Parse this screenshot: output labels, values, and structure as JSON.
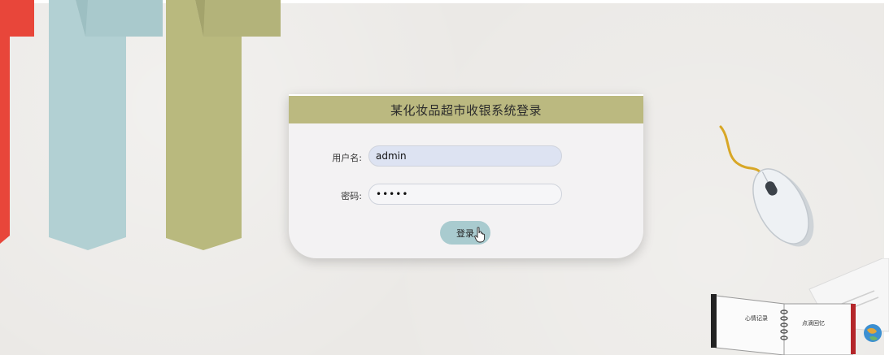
{
  "login": {
    "title": "某化妆品超市收银系统登录",
    "username_label": "用户名:",
    "username_value": "admin",
    "password_label": "密码:",
    "password_value": "•••••",
    "submit_label": "登录"
  },
  "notebook": {
    "left_page_text": "心情记录",
    "right_page_text": "点滴回忆"
  },
  "colors": {
    "header": "#bbb980",
    "button": "#a9cbcf",
    "username_field": "#dde3f2",
    "stripe_red": "#e8463a",
    "stripe_teal": "#b2d0d3",
    "stripe_olive": "#b9b97e"
  },
  "icons": [
    "hand-pointer-cursor-icon",
    "computer-mouse-icon",
    "notebook-icon",
    "globe-icon"
  ]
}
